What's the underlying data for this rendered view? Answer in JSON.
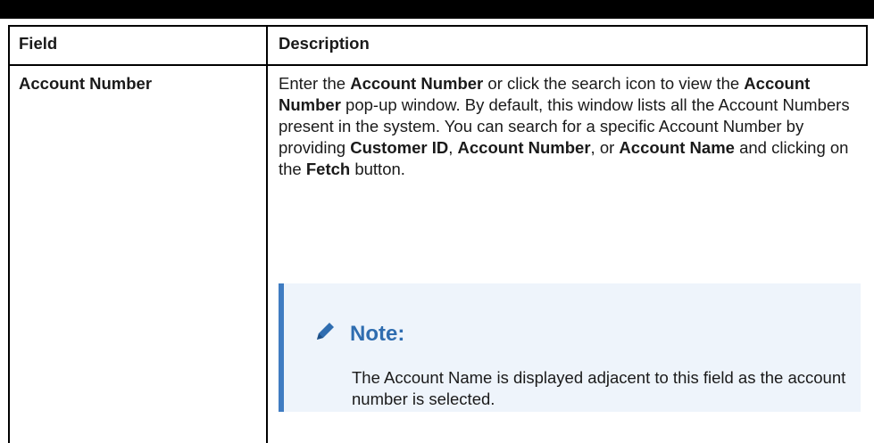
{
  "table": {
    "headers": {
      "field": "Field",
      "description": "Description"
    },
    "row": {
      "field": "Account Number",
      "description_runs": [
        {
          "text": "Enter the ",
          "bold": false
        },
        {
          "text": "Account Number",
          "bold": true
        },
        {
          "text": " or click the search icon to view the ",
          "bold": false
        },
        {
          "text": "Account Number",
          "bold": true
        },
        {
          "text": " pop-up window. By default, this window lists all the Account Numbers present in the system. You can search for a specific Account Number by providing ",
          "bold": false
        },
        {
          "text": "Customer ID",
          "bold": true
        },
        {
          "text": ", ",
          "bold": false
        },
        {
          "text": "Account Number",
          "bold": true
        },
        {
          "text": ", or ",
          "bold": false
        },
        {
          "text": "Account Name",
          "bold": true
        },
        {
          "text": " and clicking on the ",
          "bold": false
        },
        {
          "text": "Fetch",
          "bold": true
        },
        {
          "text": " button.",
          "bold": false
        }
      ],
      "note": {
        "icon": "pencil-icon",
        "title": "Note:",
        "text": "The Account Name is displayed adjacent to this field as the account number is selected."
      }
    }
  },
  "colors": {
    "note_accent": "#3f7cc2",
    "note_background": "#eef4fb",
    "note_title": "#2f6db0"
  }
}
